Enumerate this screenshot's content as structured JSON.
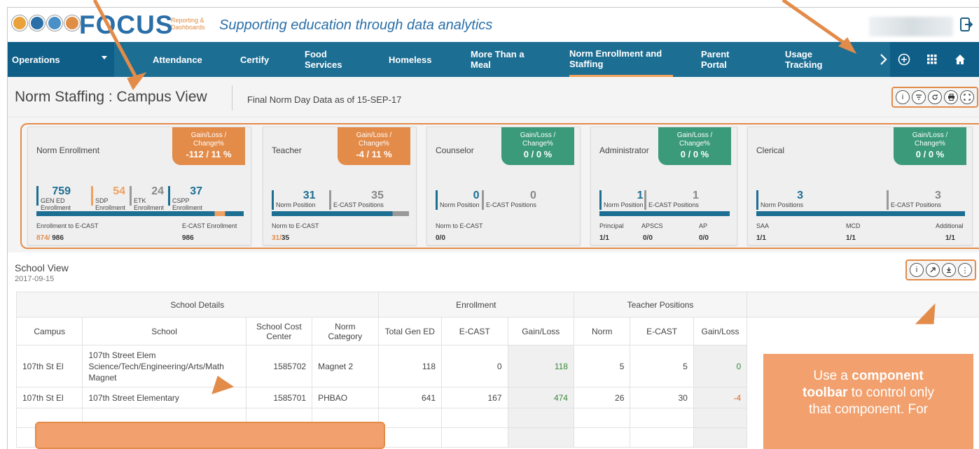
{
  "header": {
    "brand_name": "FOCUS",
    "brand_sub_line1": "Reporting &",
    "brand_sub_line2": "Dashboards",
    "tagline": "Supporting education through data analytics"
  },
  "nav": {
    "dropdown_label": "Operations",
    "items": [
      {
        "label": "Attendance"
      },
      {
        "label": "Certify"
      },
      {
        "label": "Food Services"
      },
      {
        "label": "Homeless"
      },
      {
        "label": "More Than a Meal"
      },
      {
        "label": "Norm Enrollment and Staffing"
      },
      {
        "label": "Parent Portal"
      },
      {
        "label": "Usage Tracking"
      }
    ]
  },
  "titlebar": {
    "title": "Norm Staffing : Campus View",
    "subtitle": "Final Norm Day Data as of 15-SEP-17"
  },
  "cards": {
    "gain_label": "Gain/Loss / Change%",
    "enrollment": {
      "title": "Norm Enrollment",
      "gain": "-112 / 11 %",
      "metrics": [
        {
          "num": "759",
          "label1": "GEN ED",
          "label2": "Enrollment"
        },
        {
          "num": "54",
          "label1": "SDP",
          "label2": "Enrollment"
        },
        {
          "num": "24",
          "label1": "ETK",
          "label2": "Enrollment"
        },
        {
          "num": "37",
          "label1": "CSPP",
          "label2": "Enrollment"
        }
      ],
      "foot_left_label": "Enrollment to E-CAST",
      "foot_left_a": "874/",
      "foot_left_b": "986",
      "foot_right_label": "E-CAST Enrollment",
      "foot_right_val": "986"
    },
    "teacher": {
      "title": "Teacher",
      "gain": "-4 / 11 %",
      "m1_num": "31",
      "m1_label": "Norm Position",
      "m2_num": "35",
      "m2_label": "E-CAST Positions",
      "foot_label": "Norm to E-CAST",
      "foot_a": "31/",
      "foot_b": "35"
    },
    "counselor": {
      "title": "Counselor",
      "gain": "0 / 0 %",
      "m1_num": "0",
      "m1_label": "Norm Position",
      "m2_num": "0",
      "m2_label": "E-CAST Positions",
      "foot_label": "Norm to E-CAST",
      "foot_val": "0/0"
    },
    "administrator": {
      "title": "Administrator",
      "gain": "0 / 0 %",
      "m1_num": "1",
      "m1_label": "Norm Position",
      "m2_num": "1",
      "m2_label": "E-CAST Positions",
      "foot": [
        {
          "label": "Principal",
          "val": "1/1"
        },
        {
          "label": "APSCS",
          "val": "0/0"
        },
        {
          "label": "AP",
          "val": "0/0"
        }
      ]
    },
    "clerical": {
      "title": "Clerical",
      "gain": "0 / 0 %",
      "m1_num": "3",
      "m1_label": "Norm Positions",
      "m2_num": "3",
      "m2_label": "E-CAST Positions",
      "foot": [
        {
          "label": "SAA",
          "val": "1/1"
        },
        {
          "label": "MCD",
          "val": "1/1"
        },
        {
          "label": "Additional",
          "val": "1/1"
        }
      ]
    }
  },
  "school_view": {
    "title": "School View",
    "date": "2017-09-15",
    "groups": [
      "School Details",
      "Enrollment",
      "Teacher Positions"
    ],
    "columns": [
      "Campus",
      "School",
      "School Cost Center",
      "Norm Category",
      "Total Gen ED",
      "E-CAST",
      "Gain/Loss",
      "Norm",
      "E-CAST",
      "Gain/Loss"
    ],
    "rows": [
      {
        "campus": "107th St El",
        "school": "107th Street Elem Science/Tech/Engineering/Arts/Math Magnet",
        "cost_center": "1585702",
        "category": "Magnet 2",
        "gen_ed": "118",
        "ecast": "0",
        "gain": "118",
        "norm": "5",
        "t_ecast": "5",
        "t_gain": "0"
      },
      {
        "campus": "107th St El",
        "school": "107th Street Elementary",
        "cost_center": "1585701",
        "category": "PHBAO",
        "gen_ed": "641",
        "ecast": "167",
        "gain": "474",
        "norm": "26",
        "t_ecast": "30",
        "t_gain": "-4"
      }
    ]
  },
  "callout": {
    "text_a": "Use a ",
    "text_b": "component",
    "text_c": "toolbar",
    "text_d": " to control only",
    "text_e": "that component. For"
  }
}
